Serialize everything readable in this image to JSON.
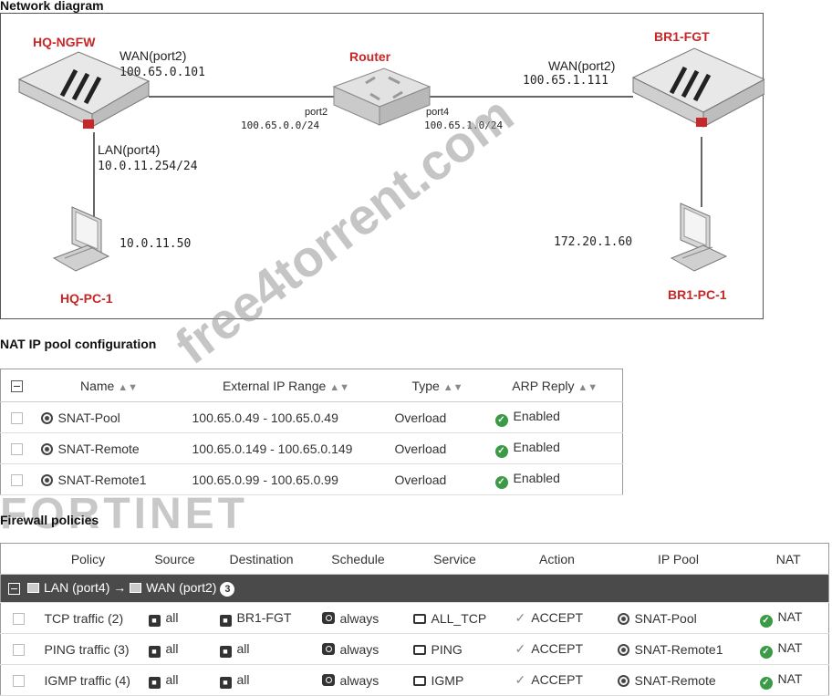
{
  "diagram": {
    "title": "Network diagram",
    "hq_ngfw": {
      "name": "HQ-NGFW",
      "wan_label": "WAN(port2)",
      "wan_ip": "100.65.0.101",
      "lan_label": "LAN(port4)",
      "lan_ip": "10.0.11.254/24"
    },
    "router": {
      "name": "Router",
      "port2_label": "port2",
      "port2_net": "100.65.0.0/24",
      "port4_label": "port4",
      "port4_net": "100.65.1.0/24"
    },
    "br1_fgt": {
      "name": "BR1-FGT",
      "wan_label": "WAN(port2)",
      "wan_ip": "100.65.1.111"
    },
    "hq_pc": {
      "name": "HQ-PC-1",
      "ip": "10.0.11.50"
    },
    "br1_pc": {
      "name": "BR1-PC-1",
      "ip": "172.20.1.60"
    }
  },
  "nat_pool": {
    "title": "NAT IP pool configuration",
    "headers": [
      "Name",
      "External IP Range",
      "Type",
      "ARP Reply"
    ],
    "rows": [
      {
        "name": "SNAT-Pool",
        "range": "100.65.0.49 - 100.65.0.49",
        "type": "Overload",
        "arp": "Enabled"
      },
      {
        "name": "SNAT-Remote",
        "range": "100.65.0.149 - 100.65.0.149",
        "type": "Overload",
        "arp": "Enabled"
      },
      {
        "name": "SNAT-Remote1",
        "range": "100.65.0.99 - 100.65.0.99",
        "type": "Overload",
        "arp": "Enabled"
      }
    ]
  },
  "firewall": {
    "title": "Firewall policies",
    "headers": [
      "Policy",
      "Source",
      "Destination",
      "Schedule",
      "Service",
      "Action",
      "IP Pool",
      "NAT"
    ],
    "group": {
      "from": "LAN (port4)",
      "arrow": "→",
      "to": "WAN (port2)",
      "count": "3"
    },
    "rows": [
      {
        "policy": "TCP traffic (2)",
        "source": "all",
        "destination": "BR1-FGT",
        "schedule": "always",
        "service": "ALL_TCP",
        "action": "ACCEPT",
        "pool": "SNAT-Pool",
        "nat": "NAT"
      },
      {
        "policy": "PING traffic (3)",
        "source": "all",
        "destination": "all",
        "schedule": "always",
        "service": "PING",
        "action": "ACCEPT",
        "pool": "SNAT-Remote1",
        "nat": "NAT"
      },
      {
        "policy": "IGMP traffic (4)",
        "source": "all",
        "destination": "all",
        "schedule": "always",
        "service": "IGMP",
        "action": "ACCEPT",
        "pool": "SNAT-Remote",
        "nat": "NAT"
      }
    ]
  },
  "logo": "FORTINET",
  "watermark": "free4torrent.com",
  "colors": {
    "device_label": "#c62828",
    "enabled": "#3a9a46",
    "group_header": "#4a4a4a"
  }
}
